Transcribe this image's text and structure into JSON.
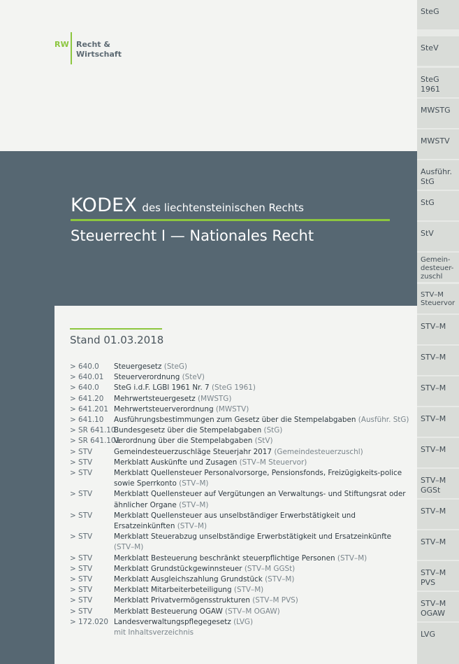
{
  "logo": {
    "mark": "RW",
    "line1": "Recht &",
    "line2": "Wirtschaft"
  },
  "header": {
    "kodex": "KODEX",
    "kodex_suffix": "des liechtensteinischen Rechts",
    "subtitle": "Steuerrecht I — Nationales Recht"
  },
  "stand": "Stand 01.03.2018",
  "toc": [
    {
      "num": "> 640.0",
      "title": "Steuergesetz",
      "abbr": "(SteG)"
    },
    {
      "num": "> 640.01",
      "title": "Steuerverordnung",
      "abbr": "(SteV)"
    },
    {
      "num": "> 640.0",
      "title": "SteG i.d.F. LGBl 1961 Nr. 7",
      "abbr": "(SteG 1961)"
    },
    {
      "num": "> 641.20",
      "title": "Mehrwertsteuergesetz",
      "abbr": "(MWSTG)"
    },
    {
      "num": "> 641.201",
      "title": "Mehrwertsteuerverordnung",
      "abbr": "(MWSTV)"
    },
    {
      "num": "> 641.10",
      "title": "Ausführungsbestimmungen zum Gesetz über die Stempelabgaben",
      "abbr": "(Ausführ. StG)"
    },
    {
      "num": "> SR 641.10",
      "title": "Bundesgesetz über die Stempelabgaben",
      "abbr": "(StG)"
    },
    {
      "num": "> SR 641.101",
      "title": "Verordnung über die Stempelabgaben",
      "abbr": "(StV)"
    },
    {
      "num": "> STV",
      "title": "Gemeindesteuerzuschläge Steuerjahr 2017",
      "abbr": "(Gemeindesteuerzuschl)"
    },
    {
      "num": "> STV",
      "title": "Merkblatt Auskünfte und Zusagen",
      "abbr": "(STV–M Steuervor)"
    },
    {
      "num": "> STV",
      "title": "Merkblatt Quellensteuer Personalvorsorge, Pensionsfonds, Freizügigkeits-police sowie Sperrkonto",
      "abbr": "(STV–M)"
    },
    {
      "num": "> STV",
      "title": "Merkblatt Quellensteuer auf Vergütungen an Verwaltungs- und Stiftungsrat oder ähnlicher Organe",
      "abbr": "(STV–M)"
    },
    {
      "num": "> STV",
      "title": "Merkblatt Quellensteuer aus unselbständiger Erwerbstätigkeit und Ersatzeinkünften",
      "abbr": "(STV–M)"
    },
    {
      "num": "> STV",
      "title": "Merkblatt Steuerabzug unselbständige Erwerbstätigkeit und Ersatzeinkünfte",
      "abbr": "(STV–M)"
    },
    {
      "num": "> STV",
      "title": "Merkblatt Besteuerung beschränkt steuerpflichtige Personen",
      "abbr": "(STV–M)"
    },
    {
      "num": "> STV",
      "title": "Merkblatt Grundstückgewinnsteuer",
      "abbr": "(STV–M GGSt)"
    },
    {
      "num": "> STV",
      "title": "Merkblatt Ausgleichszahlung Grundstück",
      "abbr": "(STV–M)"
    },
    {
      "num": "> STV",
      "title": "Merkblatt Mitarbeiterbeteiligung",
      "abbr": "(STV–M)"
    },
    {
      "num": "> STV",
      "title": "Merkblatt Privatvermögensstrukturen",
      "abbr": "(STV–M PVS)"
    },
    {
      "num": "> STV",
      "title": "Merkblatt Besteuerung OGAW",
      "abbr": "(STV–M OGAW)"
    },
    {
      "num": "> 172.020",
      "title": "Landesverwaltungspflegegesetz",
      "abbr": "(LVG)",
      "note": "mit Inhaltsverzeichnis"
    }
  ],
  "tabs": [
    {
      "line1": "SteG"
    },
    {
      "line1": "SteV"
    },
    {
      "line1": "SteG",
      "line2": "1961"
    },
    {
      "line1": "MWSTG"
    },
    {
      "line1": "MWSTV"
    },
    {
      "line1": "Ausführ.",
      "line2": "StG"
    },
    {
      "line1": "StG"
    },
    {
      "line1": "StV"
    },
    {
      "line1": "Gemein-",
      "line2": "desteuer-",
      "line3": "zuschl"
    },
    {
      "line1": "STV–M",
      "line2": "Steuervor"
    },
    {
      "line1": "STV–M"
    },
    {
      "line1": "STV–M"
    },
    {
      "line1": "STV–M"
    },
    {
      "line1": "STV–M"
    },
    {
      "line1": "STV–M"
    },
    {
      "line1": "STV–M",
      "line2": "GGSt"
    },
    {
      "line1": "STV–M"
    },
    {
      "line1": "STV–M"
    },
    {
      "line1": "STV–M",
      "line2": "PVS"
    },
    {
      "line1": "STV–M",
      "line2": "OGAW"
    },
    {
      "line1": "LVG"
    }
  ]
}
